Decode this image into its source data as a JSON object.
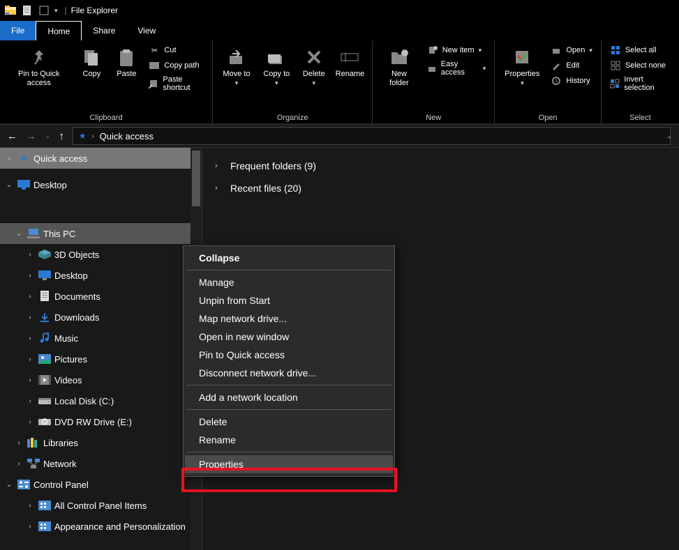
{
  "title": "File Explorer",
  "qat": [
    "folder-icon",
    "doc-icon",
    "square-icon",
    "dropdown-icon"
  ],
  "menu_tabs": [
    "File",
    "Home",
    "Share",
    "View"
  ],
  "ribbon": {
    "clipboard": {
      "label": "Clipboard",
      "pin": "Pin to Quick access",
      "copy": "Copy",
      "paste": "Paste",
      "cut": "Cut",
      "copypath": "Copy path",
      "pasteshortcut": "Paste shortcut"
    },
    "organize": {
      "label": "Organize",
      "moveto": "Move to",
      "copyto": "Copy to",
      "delete": "Delete",
      "rename": "Rename"
    },
    "new": {
      "label": "New",
      "newfolder": "New folder",
      "newitem": "New item",
      "easyaccess": "Easy access"
    },
    "open": {
      "label": "Open",
      "properties": "Properties",
      "open": "Open",
      "edit": "Edit",
      "history": "History"
    },
    "select": {
      "label": "Select",
      "all": "Select all",
      "none": "Select none",
      "invert": "Invert selection"
    }
  },
  "breadcrumb": "Quick access",
  "sidebar": {
    "quickaccess": "Quick access",
    "desktop": "Desktop",
    "thispc": "This PC",
    "items": [
      "3D Objects",
      "Desktop",
      "Documents",
      "Downloads",
      "Music",
      "Pictures",
      "Videos",
      "Local Disk (C:)",
      "DVD RW Drive (E:)"
    ],
    "libraries": "Libraries",
    "network": "Network",
    "controlpanel": "Control Panel",
    "cp_items": [
      "All Control Panel Items",
      "Appearance and Personalization"
    ]
  },
  "main": {
    "frequent": "Frequent folders (9)",
    "recent": "Recent files (20)"
  },
  "context_menu": [
    "Collapse",
    "Manage",
    "Unpin from Start",
    "Map network drive...",
    "Open in new window",
    "Pin to Quick access",
    "Disconnect network drive...",
    "Add a network location",
    "Delete",
    "Rename",
    "Properties"
  ]
}
